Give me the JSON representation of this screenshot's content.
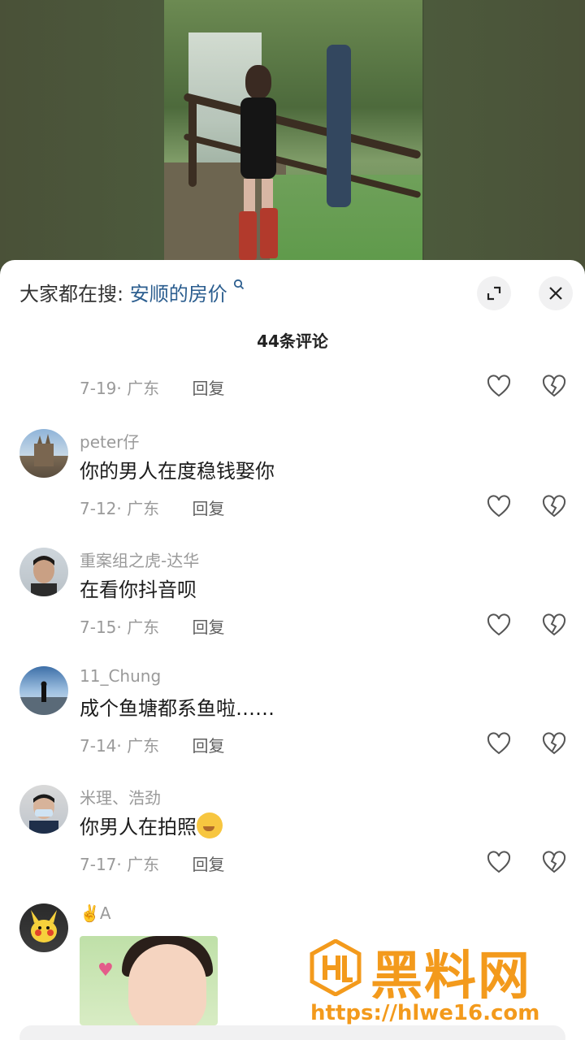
{
  "search_bar": {
    "prefix": "大家都在搜:",
    "term": "安顺的房价"
  },
  "comment_count": "44条评论",
  "icons": {
    "expand": "expand-icon",
    "close": "close-icon",
    "like": "heart-outline-icon",
    "dislike": "broken-heart-icon",
    "search": "search-icon"
  },
  "comments": [
    {
      "name": "",
      "text": "",
      "date": "7-19",
      "region": "· 广东",
      "reply": "回复"
    },
    {
      "name": "peter仔",
      "text": "你的男人在度稳钱娶你",
      "date": "7-12",
      "region": "· 广东",
      "reply": "回复"
    },
    {
      "name": "重案组之虎-达华",
      "text": "在看你抖音呗",
      "date": "7-15",
      "region": "· 广东",
      "reply": "回复"
    },
    {
      "name": "11_Chung",
      "text": "成个鱼塘都系鱼啦……",
      "date": "7-14",
      "region": "· 广东",
      "reply": "回复"
    },
    {
      "name": "米理、浩劲",
      "text": "你男人在拍照",
      "date": "7-17",
      "region": "· 广东",
      "reply": "回复"
    },
    {
      "name": "✌️A",
      "text": "",
      "date": "",
      "region": "",
      "reply": ""
    }
  ],
  "watermark": {
    "title": "黑料网",
    "url": "https://hlwe16.com"
  },
  "colors": {
    "accent_link": "#2c5e8f",
    "watermark": "#f39a1c"
  }
}
